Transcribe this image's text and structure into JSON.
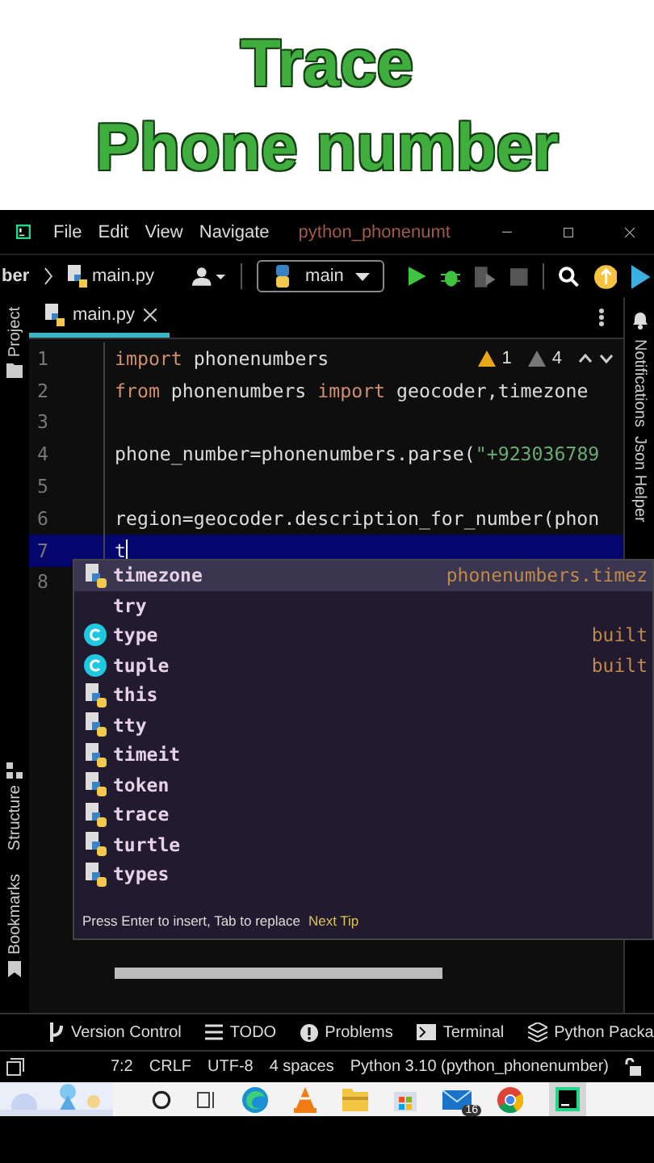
{
  "banner": {
    "lines": [
      "Trace",
      "Phone number"
    ]
  },
  "title_bar": {
    "menu": [
      "File",
      "Edit",
      "View",
      "Navigate"
    ],
    "project_title": "python_phonenumt"
  },
  "toolbar": {
    "breadcrumb": "ber",
    "file": "main.py",
    "run_config": "main"
  },
  "tool_strip_left": [
    "Project",
    "Structure",
    "Bookmarks"
  ],
  "tool_strip_right": [
    "Notifications",
    "Json Helper"
  ],
  "tabs": [
    {
      "label": "main.py",
      "selected": true
    }
  ],
  "inspections": {
    "warnings": "1",
    "weak_warnings": "4"
  },
  "code_lines": [
    {
      "number": "1",
      "current": false,
      "tokens": [
        {
          "kind": "kw",
          "text": "import"
        },
        {
          "kind": "plain",
          "text": " phonenumbers"
        }
      ]
    },
    {
      "number": "2",
      "current": false,
      "tokens": [
        {
          "kind": "kw",
          "text": "from"
        },
        {
          "kind": "plain",
          "text": " phonenumbers "
        },
        {
          "kind": "kw",
          "text": "import"
        },
        {
          "kind": "plain",
          "text": " geocoder,timezone"
        }
      ]
    },
    {
      "number": "3",
      "current": false
    },
    {
      "number": "4",
      "current": false,
      "tokens": [
        {
          "kind": "plain",
          "text": "phone_number=phonenumbers.parse("
        },
        {
          "kind": "str",
          "text": "\"+923036789"
        }
      ]
    },
    {
      "number": "5",
      "current": false
    },
    {
      "number": "6",
      "current": false,
      "tokens": [
        {
          "kind": "plain",
          "text": "region=geocoder.description_for_number(phon"
        }
      ]
    },
    {
      "number": "7",
      "current": true,
      "tokens": [
        {
          "kind": "plain",
          "text": "t"
        }
      ]
    },
    {
      "number": "8",
      "current": false
    }
  ],
  "completion": {
    "items": [
      {
        "kind": "module",
        "text": "timezone",
        "hint": "phonenumbers.timez",
        "selected": true
      },
      {
        "kind": "keyword",
        "text": "try",
        "selected": false
      },
      {
        "kind": "class",
        "text": "type",
        "hint": "built",
        "selected": false
      },
      {
        "kind": "class",
        "text": "tuple",
        "hint": "built",
        "selected": false
      },
      {
        "kind": "module",
        "text": "this",
        "selected": false
      },
      {
        "kind": "module",
        "text": "tty",
        "selected": false
      },
      {
        "kind": "module",
        "text": "timeit",
        "selected": false
      },
      {
        "kind": "module",
        "text": "token",
        "selected": false
      },
      {
        "kind": "module",
        "text": "trace",
        "selected": false
      },
      {
        "kind": "module",
        "text": "turtle",
        "selected": false
      },
      {
        "kind": "module",
        "text": "types",
        "selected": false
      }
    ],
    "footer": "Press Enter to insert, Tab to replace",
    "tip_link": "Next Tip"
  },
  "bottom_tools": [
    "Version Control",
    "TODO",
    "Problems",
    "Terminal",
    "Python Packa"
  ],
  "status_bar": [
    "7:2",
    "CRLF",
    "UTF-8",
    "4 spaces",
    "Python 3.10 (python_phonenumber)"
  ],
  "taskbar": {
    "mail_badge": "16"
  }
}
